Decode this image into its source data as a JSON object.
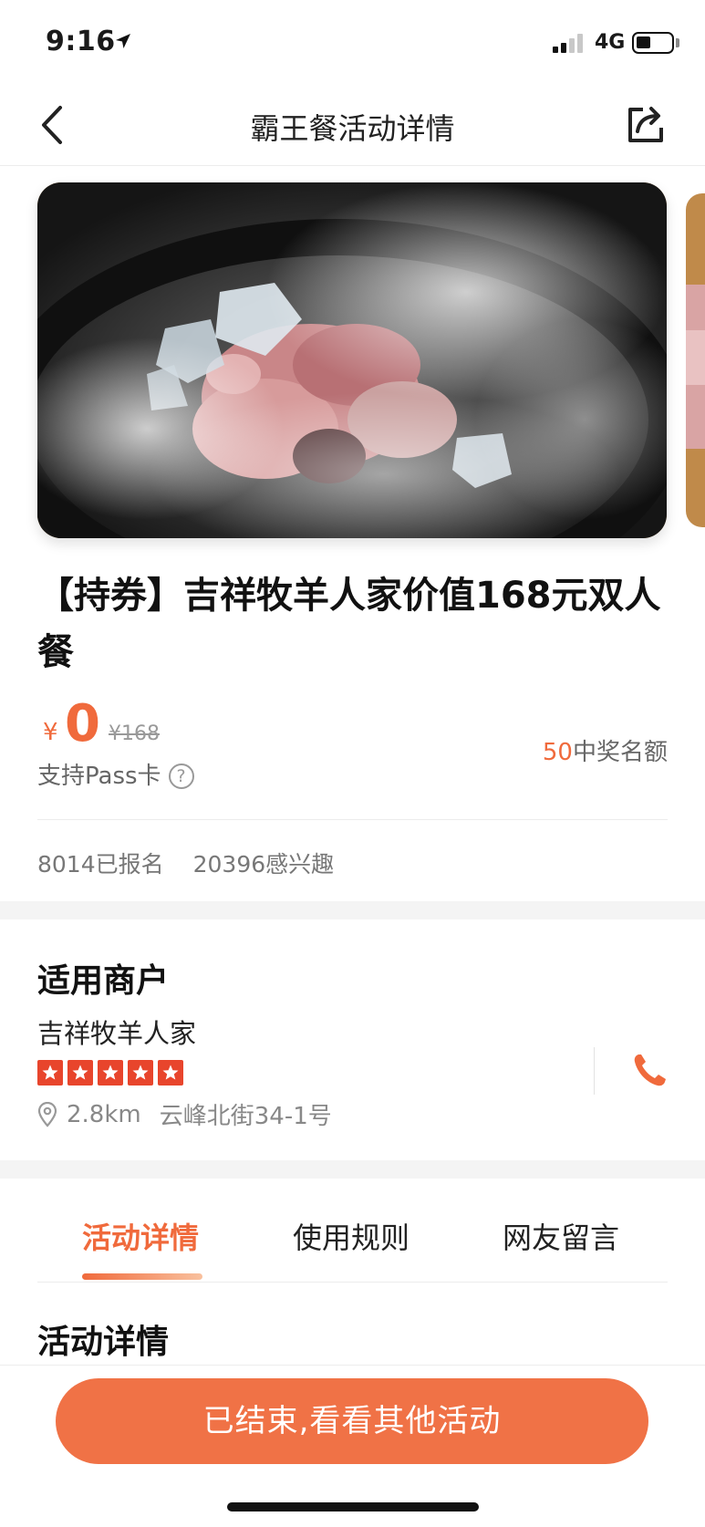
{
  "status_bar": {
    "time": "9:16",
    "network": "4G"
  },
  "nav": {
    "title": "霸王餐活动详情"
  },
  "deal": {
    "title": "【持券】吉祥牧羊人家价值168元双人餐",
    "currency": "¥",
    "price": "0",
    "original_price": "¥168",
    "pass_support": "支持Pass卡",
    "quota_count": "50",
    "quota_label": "中奖名额",
    "registered": "8014已报名",
    "interested": "20396感兴趣"
  },
  "merchant": {
    "heading": "适用商户",
    "name": "吉祥牧羊人家",
    "rating": 5,
    "distance": "2.8km",
    "address": "云峰北街34-1号"
  },
  "tabs": [
    {
      "label": "活动详情",
      "active": true
    },
    {
      "label": "使用规则",
      "active": false
    },
    {
      "label": "网友留言",
      "active": false
    }
  ],
  "details": {
    "heading": "活动详情"
  },
  "cta": {
    "label": "已结束,看看其他活动"
  },
  "colors": {
    "accent": "#f06a3c",
    "star": "#e8452c",
    "button": "#f07246"
  }
}
